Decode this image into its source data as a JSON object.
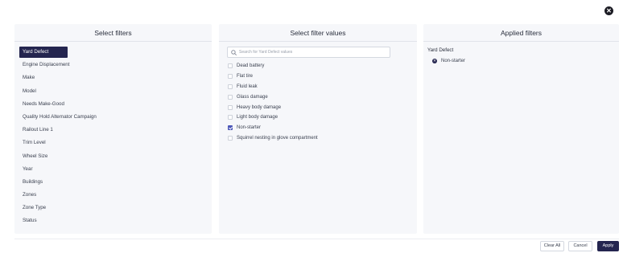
{
  "dialog": {
    "close_glyph": "✕"
  },
  "filters_panel": {
    "title": "Select filters",
    "items": [
      {
        "label": "Yard Defect",
        "active": true
      },
      {
        "label": "Engine Displacement"
      },
      {
        "label": "Make"
      },
      {
        "label": "Model"
      },
      {
        "label": "Needs Make-Good"
      },
      {
        "label": "Quality Hold Alternator Campaign"
      },
      {
        "label": "Railout Line 1"
      },
      {
        "label": "Trim Level"
      },
      {
        "label": "Wheel Size"
      },
      {
        "label": "Year"
      },
      {
        "label": "Buildings"
      },
      {
        "label": "Zones"
      },
      {
        "label": "Zone Type"
      },
      {
        "label": "Status"
      }
    ]
  },
  "values_panel": {
    "title": "Select filter values",
    "search_placeholder": "Search for Yard Defect values",
    "search_icon": "search-icon",
    "values": [
      {
        "label": "Dead battery",
        "checked": false
      },
      {
        "label": "Flat tire",
        "checked": false
      },
      {
        "label": "Fluid leak",
        "checked": false
      },
      {
        "label": "Glass damage",
        "checked": false
      },
      {
        "label": "Heavy body damage",
        "checked": false
      },
      {
        "label": "Light body damage",
        "checked": false
      },
      {
        "label": "Non-starter",
        "checked": true
      },
      {
        "label": "Squirrel nesting in glove compartment",
        "checked": false
      }
    ]
  },
  "applied_panel": {
    "title": "Applied filters",
    "groups": [
      {
        "heading": "Yard Defect",
        "values": [
          "Non-starter"
        ]
      }
    ]
  },
  "footer": {
    "clear_all_label": "Clear All",
    "cancel_label": "Cancel",
    "apply_label": "Apply"
  },
  "colors": {
    "primary": "#24254f",
    "checkbox_checked": "#4c57b8",
    "panel_bg": "#f6f7fa"
  }
}
